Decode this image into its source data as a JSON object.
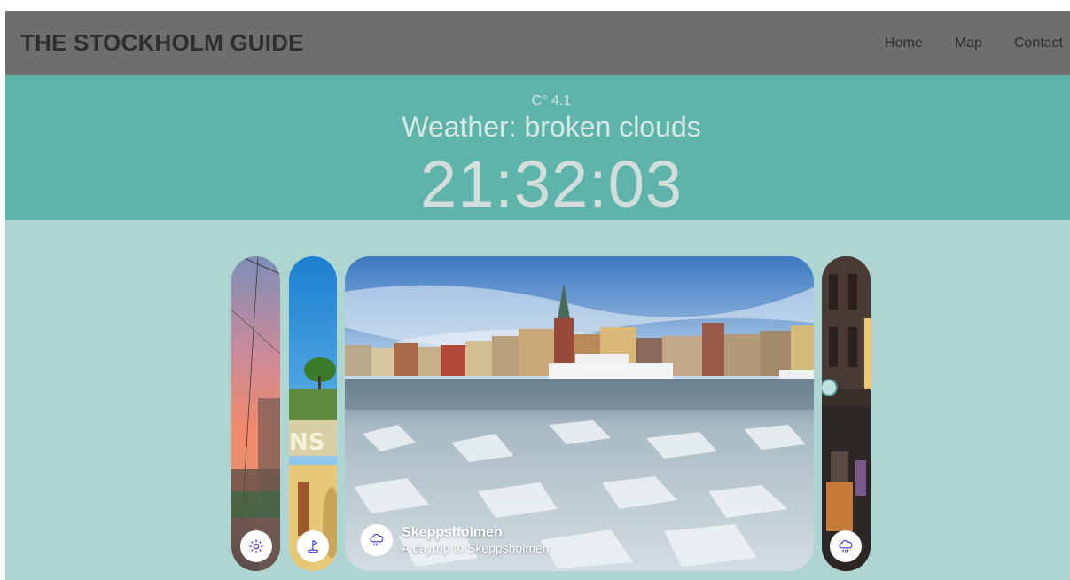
{
  "header": {
    "title": "THE STOCKHOLM GUIDE",
    "nav": {
      "home": "Home",
      "map": "Map",
      "contact": "Contact"
    }
  },
  "weather": {
    "temperature": "C° 4.1",
    "condition": "Weather: broken clouds",
    "time": "21:32:03"
  },
  "gallery": {
    "cards": [
      {
        "icon": "sun-icon"
      },
      {
        "icon": "golf-flag-icon"
      },
      {
        "icon": "rain-cloud-icon",
        "title": "Skeppsholmen",
        "subtitle": "A daytrip to Skeppsholmen"
      },
      {
        "icon": "rain-cloud-icon"
      }
    ]
  },
  "colors": {
    "header_bg": "#6e6e6e",
    "weather_bg": "#5fb4aa",
    "gallery_bg": "#aed5d1",
    "icon_accent": "#3b3bd1"
  }
}
